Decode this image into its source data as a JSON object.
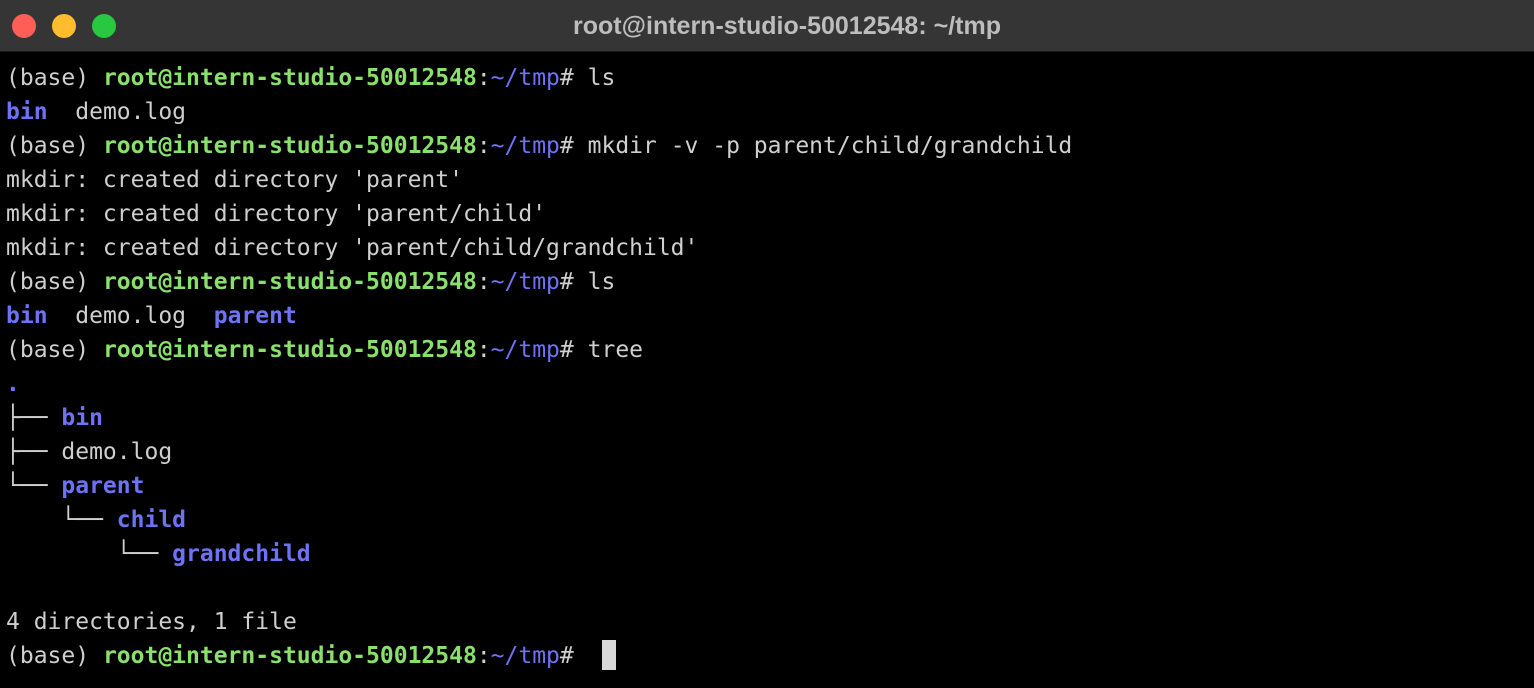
{
  "window": {
    "title": "root@intern-studio-50012548: ~/tmp"
  },
  "colors": {
    "background": "#000000",
    "text": "#cfcfcf",
    "prompt_user": "#8ae06c",
    "prompt_path": "#6e73f5",
    "directory": "#6e73f5",
    "close": "#ff5f57",
    "minimize": "#febc2e",
    "zoom": "#28c840"
  },
  "prompt": {
    "env": "(base) ",
    "user_host": "root@intern-studio-50012548",
    "colon": ":",
    "path": "~/tmp",
    "symbol": "# "
  },
  "terminal": {
    "cmd1": "ls",
    "ls1": {
      "bin": "bin",
      "sep": "  ",
      "demo": "demo.log"
    },
    "cmd2": "mkdir -v -p parent/child/grandchild",
    "mkdir_out": [
      "mkdir: created directory 'parent'",
      "mkdir: created directory 'parent/child'",
      "mkdir: created directory 'parent/child/grandchild'"
    ],
    "cmd3": "ls",
    "ls2": {
      "bin": "bin",
      "sep1": "  ",
      "demo": "demo.log",
      "sep2": "  ",
      "parent": "parent"
    },
    "cmd4": "tree",
    "tree": {
      "root": ".",
      "item1_branch": "├── ",
      "item1": "bin",
      "item2_branch": "├── ",
      "item2": "demo.log",
      "item3_branch": "└── ",
      "item3": "parent",
      "item4_branch": "    └── ",
      "item4": "child",
      "item5_branch": "        └── ",
      "item5": "grandchild"
    },
    "summary": "4 directories, 1 file"
  }
}
